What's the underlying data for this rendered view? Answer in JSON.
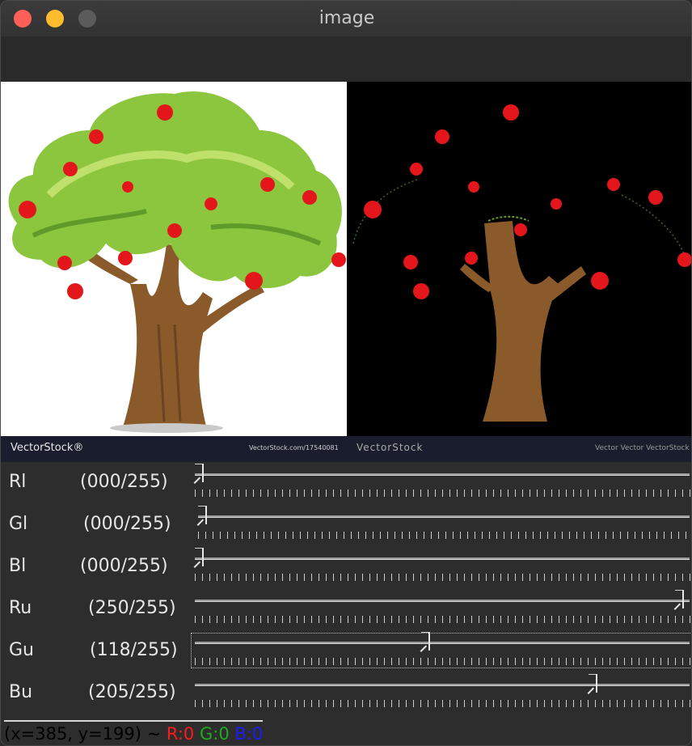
{
  "window": {
    "title": "image"
  },
  "colors": {
    "apple_red": "#e3171b",
    "trunk_brown": "#8a5a2b",
    "leaf_green": "#8cc63f",
    "banner": "#1a1d2e"
  },
  "banner": {
    "logo": "VectorStock®",
    "url": "VectorStock.com/17540081",
    "id": "VectorStock",
    "credit": "Vector Vector VectorStock"
  },
  "sliders": [
    {
      "name": "Rl",
      "value_text": "(000/255)",
      "value": 0,
      "max": 255,
      "focused": false
    },
    {
      "name": "Gl",
      "value_text": "(000/255)",
      "value": 0,
      "max": 255,
      "focused": false
    },
    {
      "name": "Bl",
      "value_text": "(000/255)",
      "value": 0,
      "max": 255,
      "focused": false
    },
    {
      "name": "Ru",
      "value_text": "(250/255)",
      "value": 250,
      "max": 255,
      "focused": false
    },
    {
      "name": "Gu",
      "value_text": "(118/255)",
      "value": 118,
      "max": 255,
      "focused": true
    },
    {
      "name": "Bu",
      "value_text": "(205/255)",
      "value": 205,
      "max": 255,
      "focused": false
    }
  ],
  "status": {
    "coords": "(x=385, y=199) ~ ",
    "r": "R:0",
    "g": "G:0",
    "b": "B:0"
  }
}
